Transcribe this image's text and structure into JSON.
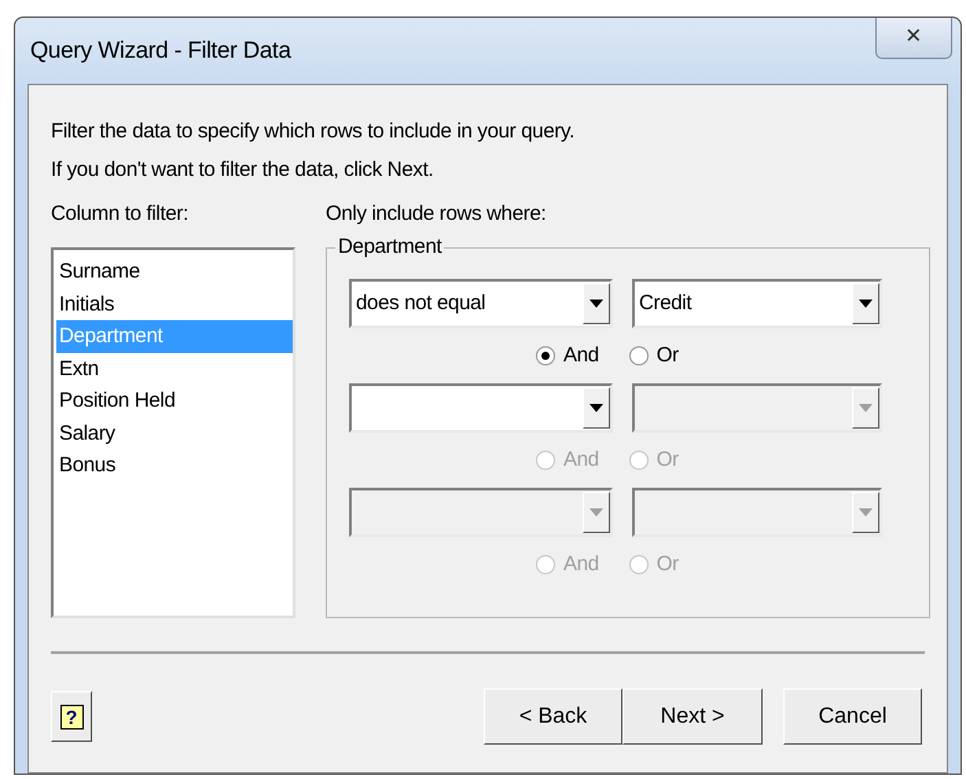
{
  "window": {
    "title": "Query Wizard - Filter Data",
    "close_glyph": "✕"
  },
  "instructions": [
    "Filter the data to specify which rows to include in your query.",
    "If you don't want to filter the data, click Next."
  ],
  "column_list": {
    "label": "Column to filter:",
    "items": [
      {
        "label": "Surname",
        "selected": false
      },
      {
        "label": "Initials",
        "selected": false
      },
      {
        "label": "Department",
        "selected": true
      },
      {
        "label": "Extn",
        "selected": false
      },
      {
        "label": "Position Held",
        "selected": false
      },
      {
        "label": "Salary",
        "selected": false
      },
      {
        "label": "Bonus",
        "selected": false
      }
    ]
  },
  "criteria": {
    "label": "Only include rows where:",
    "group_title": "Department",
    "conditions": [
      {
        "operator": {
          "value": "does not equal",
          "disabled": false
        },
        "operand": {
          "value": "Credit",
          "disabled": false
        },
        "logic": [
          {
            "label": "And",
            "selected": true,
            "disabled": false
          },
          {
            "label": "Or",
            "selected": false,
            "disabled": false
          }
        ]
      },
      {
        "operator": {
          "disabled": false
        },
        "operand": {
          "disabled": true
        },
        "logic": [
          {
            "label": "And",
            "selected": false,
            "disabled": true
          },
          {
            "label": "Or",
            "selected": false,
            "disabled": true
          }
        ]
      },
      {
        "operator": {
          "disabled": true
        },
        "operand": {
          "disabled": true
        },
        "logic": [
          {
            "label": "And",
            "selected": false,
            "disabled": true
          },
          {
            "label": "Or",
            "selected": false,
            "disabled": true
          }
        ]
      }
    ]
  },
  "help_button": {
    "label": "?"
  },
  "buttons": [
    {
      "label": "< Back"
    },
    {
      "label": "Next >"
    },
    {
      "label": "Cancel"
    }
  ]
}
